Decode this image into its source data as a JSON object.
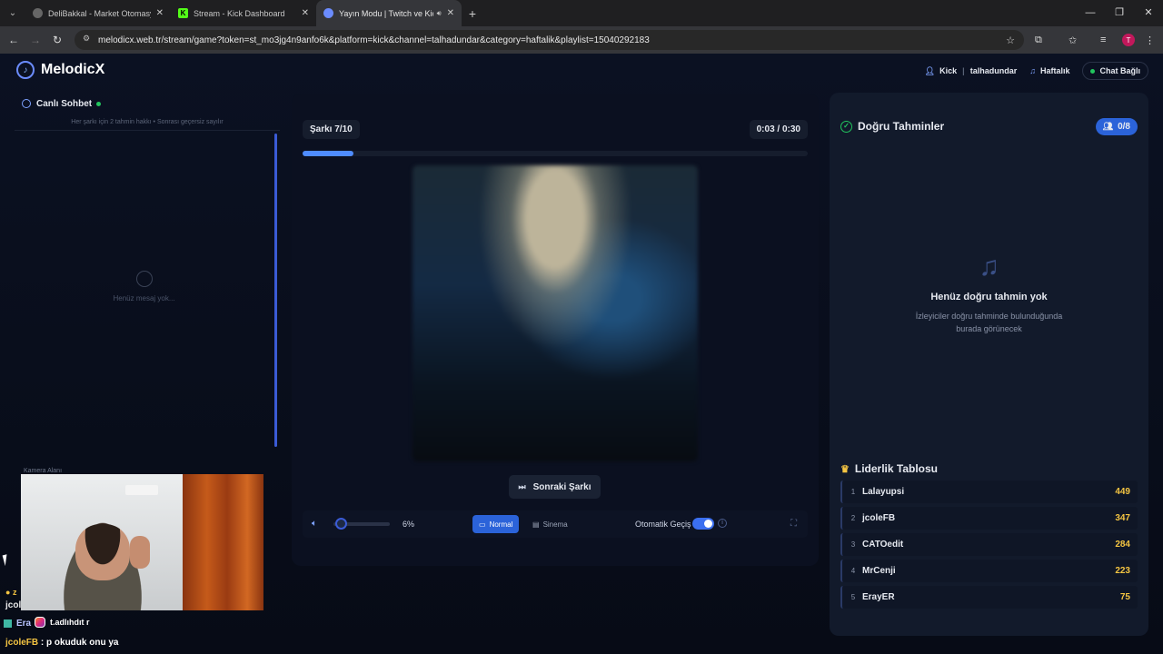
{
  "browser": {
    "tabs": [
      {
        "title": "DeliBakkal - Market Otomasyonu",
        "active": false
      },
      {
        "title": "Stream - Kick Dashboard",
        "active": false
      },
      {
        "title": "Yayın Modu | Twitch ve Kick",
        "active": true
      }
    ],
    "url": "melodicx.web.tr/stream/game?token=st_mo3jg4n9anfo6k&platform=kick&channel=talhadundar&category=haftalik&playlist=15040292183",
    "profile_initial": "T"
  },
  "header": {
    "app_name": "MelodicX",
    "platform": "Kick",
    "channel": "talhadundar",
    "category": "Haftalık",
    "chat_status": "Chat Bağlı"
  },
  "chat": {
    "title": "Canlı Sohbet",
    "rule": "Her şarkı için 2 tahmin hakkı • Sonrası geçersiz sayılır",
    "empty": "Henüz mesaj yok..."
  },
  "camera": {
    "label": "Kamera Alanı"
  },
  "stream_overlay": {
    "line1": "z",
    "line2": "jcol",
    "line3_user": "Era",
    "instagram_text": "t.adlıhdıt r",
    "line4_user": "jcoleFB",
    "line4_msg": " : p okuduk onu ya"
  },
  "player": {
    "song_counter": "Şarkı 7/10",
    "time": "0:03  /  0:30",
    "progress": 0.1,
    "next_label": "Sonraki Şarkı",
    "volume_label": "6%",
    "volume": 0.06,
    "mode_normal": "Normal",
    "mode_cinema": "Sinema",
    "auto_label": "Otomatik Geçiş",
    "auto_on": true
  },
  "right": {
    "title": "Doğru Tahminler",
    "count": "0/8",
    "empty_title": "Henüz doğru tahmin yok",
    "empty_sub1": "İzleyiciler doğru tahminde bulunduğunda",
    "empty_sub2": "burada görünecek"
  },
  "leaderboard": {
    "title": "Liderlik Tablosu",
    "rows": [
      {
        "rank": "1",
        "name": "Lalayupsi",
        "points": "449"
      },
      {
        "rank": "2",
        "name": "jcoleFB",
        "points": "347"
      },
      {
        "rank": "3",
        "name": "CATOedit",
        "points": "284"
      },
      {
        "rank": "4",
        "name": "MrCenji",
        "points": "223"
      },
      {
        "rank": "5",
        "name": "ErayER",
        "points": "75"
      }
    ]
  },
  "colors": {
    "accent": "#2b63d9",
    "success": "#22c55e",
    "gold": "#f5c542"
  }
}
